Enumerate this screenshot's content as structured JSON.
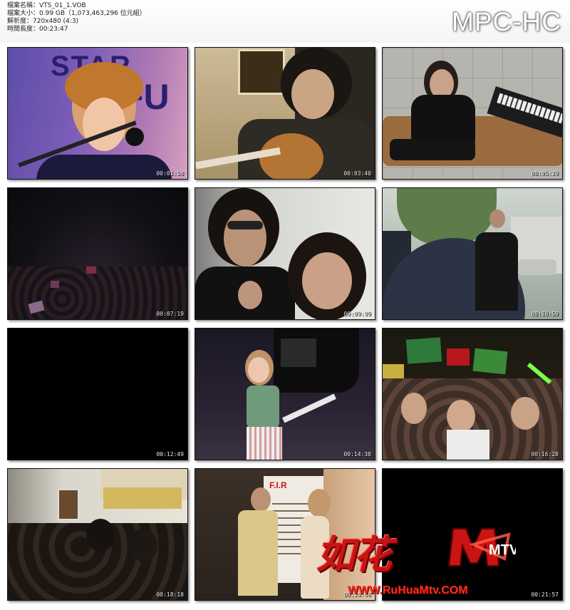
{
  "header": {
    "file_name": "檔案名稱：VTS_01_1.VOB",
    "file_size": "檔案大小：0.99 GB（1,073,463,296 位元組）",
    "resolution": "解析度：720x480 (4:3)",
    "duration": "時間長度：00:23:47",
    "player_logo": "MPC-HC"
  },
  "thumbnails": [
    {
      "time": "00:01:50",
      "scene": "singer-microphone-close-up"
    },
    {
      "time": "00:03:40",
      "scene": "guitarist-playing-acoustic-guitar"
    },
    {
      "time": "00:05:29",
      "scene": "man-on-sofa-with-keyboard"
    },
    {
      "time": "00:07:19",
      "scene": "dark-concert-crowd"
    },
    {
      "time": "00:09:09",
      "scene": "two-people-interview"
    },
    {
      "time": "00:10:59",
      "scene": "street-walking"
    },
    {
      "time": "00:12:49",
      "scene": "black-frame"
    },
    {
      "time": "00:14:38",
      "scene": "female-singer-on-stage"
    },
    {
      "time": "00:16:28",
      "scene": "fans-holding-signs"
    },
    {
      "time": "00:18:18",
      "scene": "crowd-on-street"
    },
    {
      "time": "00:20:08",
      "scene": "host-with-singer-event"
    },
    {
      "time": "00:21:57",
      "scene": "black-frame"
    }
  ],
  "watermark": {
    "chinese_text": "如花",
    "mark_text": "MTV",
    "url": "WWW.RuHuaMtv.COM"
  },
  "colors": {
    "watermark_red": "#c91414",
    "background": "#ffffff"
  }
}
